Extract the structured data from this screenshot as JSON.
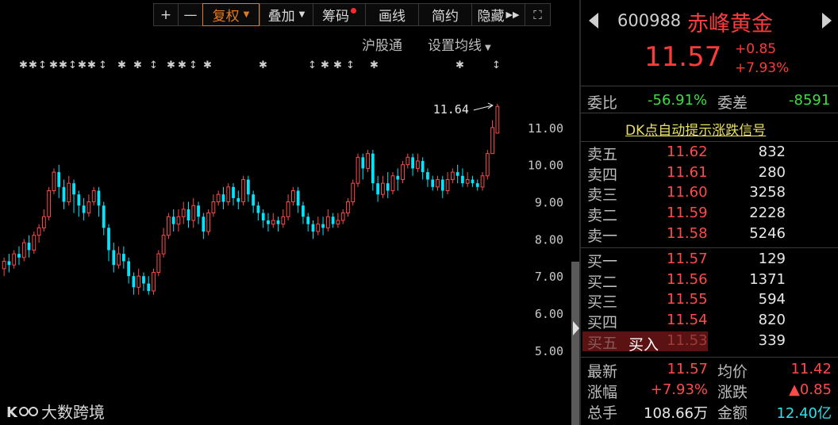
{
  "toolbar": {
    "zoom_in": "+",
    "zoom_out": "—",
    "fuquan": "复权",
    "diejia": "叠加",
    "chouma": "筹码",
    "huaxian": "画线",
    "jianyue": "简约",
    "yincang": "隐藏",
    "expand_glyph": "⛶"
  },
  "sub_links": {
    "hugutong": "沪股通",
    "ma_settings": "设置均线"
  },
  "chart_data": {
    "type": "candlestick",
    "y_ticks": [
      "11.00",
      "10.00",
      "9.00",
      "8.00",
      "7.00",
      "6.00",
      "5.00"
    ],
    "ylim": [
      4.4,
      12.3
    ],
    "annotation_high": "11.64",
    "up_color": "#ff4a4a",
    "down_color": "#00e6ff",
    "candles": [
      [
        7.2,
        7.4,
        7.0,
        7.5
      ],
      [
        7.4,
        7.3,
        7.1,
        7.6
      ],
      [
        7.3,
        7.6,
        7.2,
        7.7
      ],
      [
        7.6,
        7.5,
        7.3,
        7.8
      ],
      [
        7.5,
        7.9,
        7.4,
        8.0
      ],
      [
        7.9,
        7.7,
        7.5,
        8.1
      ],
      [
        7.7,
        8.1,
        7.6,
        8.2
      ],
      [
        8.1,
        8.3,
        7.9,
        8.4
      ],
      [
        8.3,
        8.6,
        8.2,
        8.8
      ],
      [
        8.6,
        9.3,
        8.5,
        9.4
      ],
      [
        9.3,
        9.8,
        9.2,
        9.9
      ],
      [
        9.8,
        9.4,
        9.1,
        10.0
      ],
      [
        9.4,
        9.0,
        8.8,
        9.6
      ],
      [
        9.0,
        9.5,
        8.9,
        9.7
      ],
      [
        9.5,
        9.2,
        8.7,
        9.6
      ],
      [
        9.2,
        8.9,
        8.6,
        9.3
      ],
      [
        8.9,
        8.7,
        8.5,
        9.1
      ],
      [
        8.7,
        9.0,
        8.6,
        9.2
      ],
      [
        9.0,
        9.3,
        8.9,
        9.4
      ],
      [
        9.3,
        8.9,
        8.6,
        9.4
      ],
      [
        8.9,
        8.3,
        8.1,
        9.0
      ],
      [
        8.3,
        7.7,
        7.4,
        8.4
      ],
      [
        7.7,
        7.3,
        7.1,
        7.9
      ],
      [
        7.3,
        7.6,
        7.2,
        7.8
      ],
      [
        7.6,
        7.4,
        7.2,
        7.8
      ],
      [
        7.4,
        7.0,
        6.8,
        7.5
      ],
      [
        7.0,
        6.7,
        6.5,
        7.1
      ],
      [
        6.7,
        7.0,
        6.5,
        7.2
      ],
      [
        7.0,
        6.8,
        6.6,
        7.1
      ],
      [
        6.8,
        6.6,
        6.5,
        7.0
      ],
      [
        6.6,
        7.1,
        6.5,
        7.2
      ],
      [
        7.1,
        7.6,
        7.0,
        7.7
      ],
      [
        7.6,
        8.1,
        7.5,
        8.3
      ],
      [
        8.1,
        8.6,
        8.0,
        8.7
      ],
      [
        8.6,
        8.4,
        8.2,
        8.8
      ],
      [
        8.4,
        8.6,
        8.2,
        8.8
      ],
      [
        8.6,
        8.8,
        8.4,
        9.0
      ],
      [
        8.8,
        8.5,
        8.3,
        9.0
      ],
      [
        8.5,
        8.9,
        8.3,
        9.1
      ],
      [
        8.9,
        8.6,
        8.4,
        9.0
      ],
      [
        8.6,
        8.2,
        8.0,
        8.7
      ],
      [
        8.2,
        8.7,
        8.1,
        8.8
      ],
      [
        8.7,
        9.0,
        8.6,
        9.2
      ],
      [
        9.0,
        9.2,
        8.9,
        9.3
      ],
      [
        9.2,
        9.0,
        8.8,
        9.4
      ],
      [
        9.0,
        9.4,
        8.9,
        9.5
      ],
      [
        9.4,
        9.1,
        8.9,
        9.5
      ],
      [
        9.1,
        9.0,
        8.8,
        9.3
      ],
      [
        9.0,
        9.6,
        8.9,
        9.7
      ],
      [
        9.6,
        9.2,
        9.0,
        9.7
      ],
      [
        9.2,
        8.9,
        8.7,
        9.3
      ],
      [
        8.9,
        8.7,
        8.5,
        9.0
      ],
      [
        8.7,
        8.5,
        8.3,
        8.8
      ],
      [
        8.5,
        8.4,
        8.2,
        8.7
      ],
      [
        8.4,
        8.5,
        8.3,
        8.7
      ],
      [
        8.5,
        8.4,
        8.2,
        8.6
      ],
      [
        8.4,
        8.6,
        8.3,
        8.8
      ],
      [
        8.6,
        9.0,
        8.5,
        9.2
      ],
      [
        9.0,
        9.3,
        8.9,
        9.4
      ],
      [
        9.3,
        8.9,
        8.7,
        9.4
      ],
      [
        8.9,
        8.6,
        8.4,
        9.0
      ],
      [
        8.6,
        8.4,
        8.2,
        8.7
      ],
      [
        8.4,
        8.2,
        8.0,
        8.5
      ],
      [
        8.2,
        8.4,
        8.1,
        8.6
      ],
      [
        8.4,
        8.3,
        8.1,
        8.6
      ],
      [
        8.3,
        8.6,
        8.2,
        8.8
      ],
      [
        8.6,
        8.4,
        8.3,
        8.7
      ],
      [
        8.4,
        8.5,
        8.3,
        8.7
      ],
      [
        8.5,
        8.7,
        8.4,
        8.8
      ],
      [
        8.7,
        9.0,
        8.6,
        9.1
      ],
      [
        9.0,
        9.5,
        8.9,
        9.6
      ],
      [
        9.5,
        10.2,
        9.4,
        10.3
      ],
      [
        10.2,
        9.9,
        9.6,
        10.3
      ],
      [
        9.9,
        10.3,
        9.8,
        10.4
      ],
      [
        10.3,
        9.5,
        9.3,
        10.4
      ],
      [
        9.5,
        9.2,
        9.0,
        9.7
      ],
      [
        9.2,
        9.5,
        9.1,
        9.7
      ],
      [
        9.5,
        9.3,
        9.1,
        9.8
      ],
      [
        9.3,
        9.7,
        9.2,
        9.8
      ],
      [
        9.7,
        9.6,
        9.3,
        9.9
      ],
      [
        9.6,
        10.0,
        9.5,
        10.1
      ],
      [
        10.0,
        10.2,
        9.9,
        10.3
      ],
      [
        10.2,
        9.9,
        9.7,
        10.3
      ],
      [
        9.9,
        10.1,
        9.8,
        10.3
      ],
      [
        10.1,
        9.8,
        9.6,
        10.2
      ],
      [
        9.8,
        9.6,
        9.4,
        9.9
      ],
      [
        9.6,
        9.4,
        9.3,
        9.7
      ],
      [
        9.4,
        9.6,
        9.3,
        9.7
      ],
      [
        9.6,
        9.3,
        9.1,
        9.7
      ],
      [
        9.3,
        9.6,
        9.2,
        9.8
      ],
      [
        9.6,
        9.8,
        9.5,
        9.9
      ],
      [
        9.8,
        9.7,
        9.5,
        10.0
      ],
      [
        9.7,
        9.5,
        9.4,
        9.9
      ],
      [
        9.5,
        9.6,
        9.4,
        9.8
      ],
      [
        9.6,
        9.5,
        9.4,
        9.7
      ],
      [
        9.5,
        9.4,
        9.3,
        9.6
      ],
      [
        9.4,
        9.7,
        9.3,
        9.8
      ],
      [
        9.7,
        10.3,
        9.6,
        10.4
      ],
      [
        10.3,
        11.0,
        10.3,
        11.2
      ],
      [
        10.85,
        11.57,
        10.9,
        11.64
      ]
    ]
  },
  "markers": "★★★★★★★★★★★★★★★★★★★★",
  "watermark": "大数跨境",
  "stock": {
    "code": "600988",
    "name": "赤峰黄金",
    "price": "11.57",
    "change": "+0.85",
    "change_pct": "+7.93%",
    "weibi_label": "委比",
    "weibi": "-56.91%",
    "weicha_label": "委差",
    "weicha": "-8591",
    "dk_text": "DK点自动提示涨跌信号"
  },
  "asks": [
    {
      "label": "卖五",
      "price": "11.62",
      "vol": "832"
    },
    {
      "label": "卖四",
      "price": "11.61",
      "vol": "280"
    },
    {
      "label": "卖三",
      "price": "11.60",
      "vol": "3258"
    },
    {
      "label": "卖二",
      "price": "11.59",
      "vol": "2228"
    },
    {
      "label": "卖一",
      "price": "11.58",
      "vol": "5246"
    }
  ],
  "bids": [
    {
      "label": "买一",
      "price": "11.57",
      "vol": "129"
    },
    {
      "label": "买二",
      "price": "11.56",
      "vol": "1371"
    },
    {
      "label": "买三",
      "price": "11.55",
      "vol": "594"
    },
    {
      "label": "买四",
      "price": "11.54",
      "vol": "820"
    },
    {
      "label": "买五",
      "price": "11.53",
      "vol": "339"
    }
  ],
  "buy_tag": "买入",
  "stats": {
    "latest_label": "最新",
    "latest": "11.57",
    "avg_label": "均价",
    "avg": "11.42",
    "pct_label": "涨幅",
    "pct": "+7.93%",
    "chg_label": "涨跌",
    "chg": "▲0.85",
    "vol_label": "总手",
    "vol": "108.66万",
    "amt_label": "金额",
    "amt": "12.40亿"
  }
}
